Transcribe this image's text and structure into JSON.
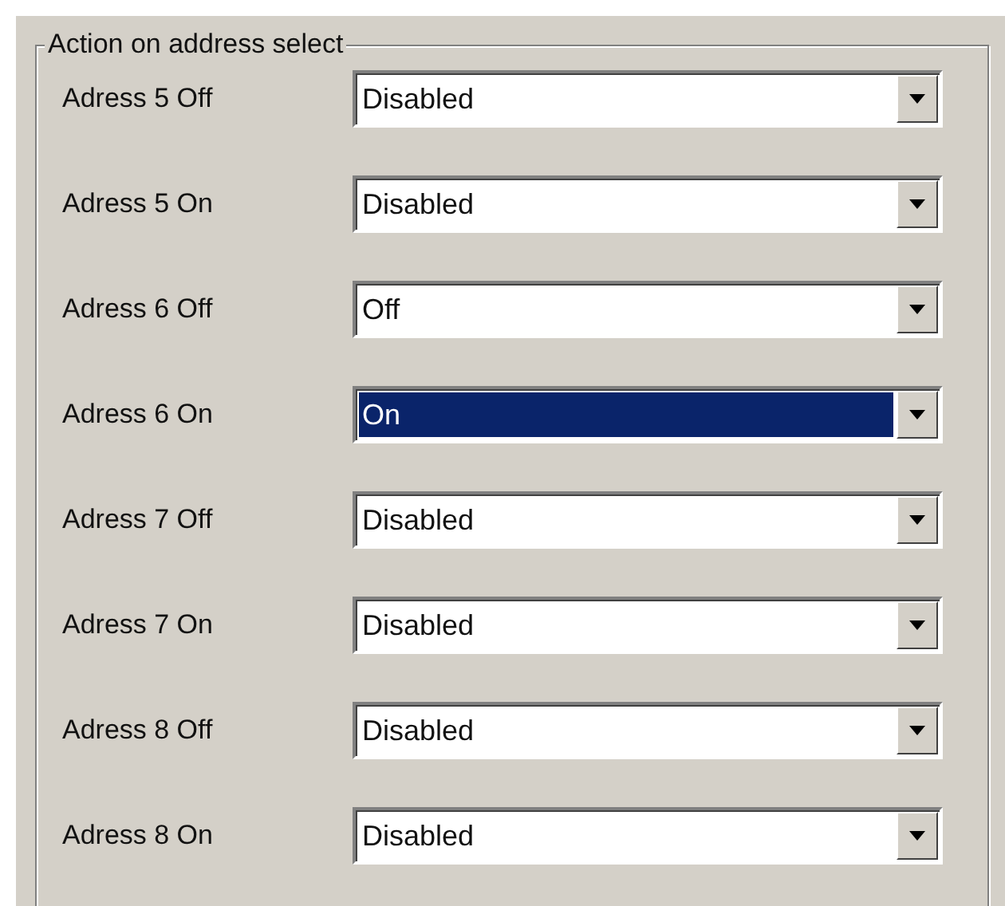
{
  "group": {
    "title": "Action on address select"
  },
  "rows": [
    {
      "label": "Adress 5 Off",
      "value": "Disabled",
      "focused": false
    },
    {
      "label": "Adress 5 On",
      "value": "Disabled",
      "focused": false
    },
    {
      "label": "Adress 6 Off",
      "value": "Off",
      "focused": false
    },
    {
      "label": "Adress 6 On",
      "value": "On",
      "focused": true
    },
    {
      "label": "Adress 7 Off",
      "value": "Disabled",
      "focused": false
    },
    {
      "label": "Adress 7 On",
      "value": "Disabled",
      "focused": false
    },
    {
      "label": "Adress 8 Off",
      "value": "Disabled",
      "focused": false
    },
    {
      "label": "Adress 8 On",
      "value": "Disabled",
      "focused": false
    }
  ]
}
